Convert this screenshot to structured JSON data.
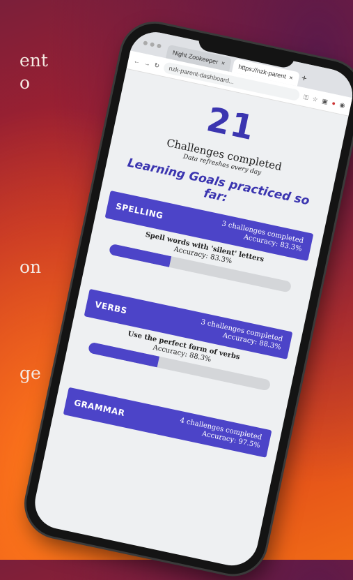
{
  "background_text": [
    "ent",
    "o",
    "on",
    "ge"
  ],
  "browser": {
    "tabs": [
      {
        "title": "Night Zookeeper",
        "close": "×"
      },
      {
        "title": "https://nzk-parent",
        "close": "×"
      }
    ],
    "new_tab": "+",
    "url": "nzk-parent-dashboard..."
  },
  "dashboard": {
    "count": "21",
    "count_label": "Challenges completed",
    "refresh_note": "Data refreshes every day",
    "goals_title": "Learning Goals practiced so far:"
  },
  "goals": [
    {
      "name": "SPELLING",
      "challenges": "3 challenges completed",
      "accuracy": "Accuracy: 83.3%",
      "skill": "Spell words with 'silent' letters",
      "skill_accuracy": "Accuracy: 83.3%",
      "progress": 0.333
    },
    {
      "name": "VERBS",
      "challenges": "3 challenges completed",
      "accuracy": "Accuracy: 88.3%",
      "skill": "Use the perfect form of verbs",
      "skill_accuracy": "Accuracy: 88.3%",
      "progress": 0.383
    },
    {
      "name": "GRAMMAR",
      "challenges": "4 challenges completed",
      "accuracy": "Accuracy: 97.5%"
    }
  ],
  "colors": {
    "accent": "#4c44c8",
    "title": "#3b35b0"
  }
}
